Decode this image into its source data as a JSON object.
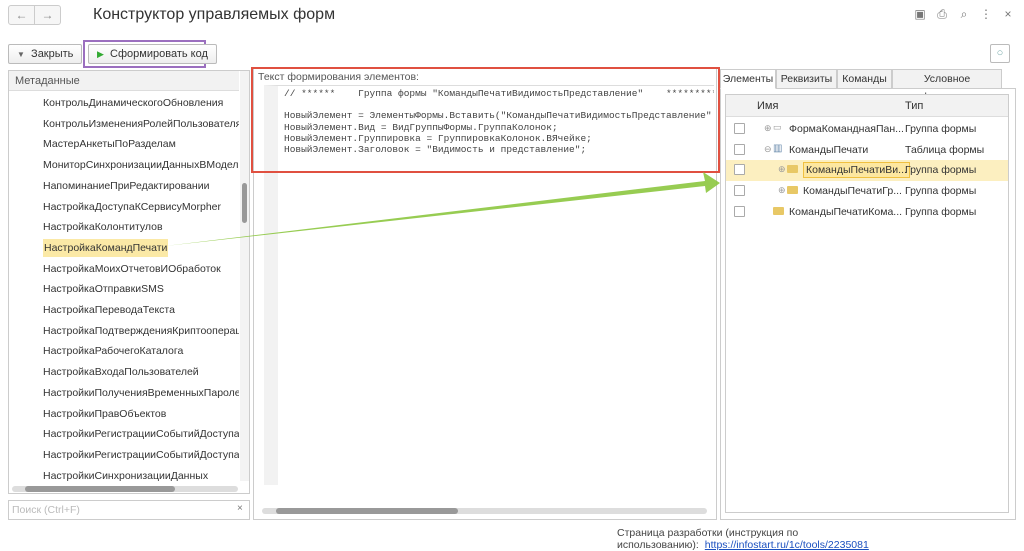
{
  "window": {
    "title": "Конструктор управляемых форм",
    "back": "←",
    "forward": "→"
  },
  "toolbar": {
    "close_label": "Закрыть",
    "generate_label": "Сформировать код"
  },
  "left": {
    "header": "Метаданные",
    "items": [
      "КонтрольДинамическогоОбновления",
      "КонтрольИзмененияРолейПользователяИБ",
      "МастерАнкетыПоРазделам",
      "МониторСинхронизацииДанныхВМоделиСерв",
      "НапоминаниеПриРедактировании",
      "НастройкаДоступаКСервисуMorpher",
      "НастройкаКолонтитулов",
      "НастройкаКомандПечати",
      "НастройкаМоихОтчетовИОбработок",
      "НастройкаОтправкиSMS",
      "НастройкаПереводаТекста",
      "НастройкаПодтвержденияКриптооперации",
      "НастройкаРабочегоКаталога",
      "НастройкаВходаПользователей",
      "НастройкиПолученияВременныхПаролей",
      "НастройкиПравОбъектов",
      "НастройкиРегистрацииСобытийДоступаКДанн",
      "НастройкиРегистрацииСобытийДоступаКПерс",
      "НастройкиСинхронизацииДанных"
    ],
    "selected_index": 7,
    "search_placeholder": "Поиск (Ctrl+F)",
    "search_clear": "×"
  },
  "middle": {
    "label": "Текст формирования элементов:",
    "code": "// ******    Группа формы \"КомандыПечатиВидимостьПредставление\"    **********\n\nНовыйЭлемент = ЭлементыФормы.Вставить(\"КомандыПечатиВидимостьПредставление\"\nНовыйЭлемент.Вид = ВидГруппыФормы.ГруппаКолонок;\nНовыйЭлемент.Группировка = ГруппировкаКолонок.ВЯчейке;\nНовыйЭлемент.Заголовок = \"Видимость и представление\";"
  },
  "right": {
    "tabs": [
      "Элементы",
      "Реквизиты",
      "Команды",
      "Условное оформление"
    ],
    "columns": {
      "name": "Имя",
      "type": "Тип"
    },
    "rows": [
      {
        "name": "ФормаКоманднаяПан...",
        "type": "Группа формы"
      },
      {
        "name": "КомандыПечати",
        "type": "Таблица формы"
      },
      {
        "name": "КомандыПечатиВи...",
        "type": "Группа формы"
      },
      {
        "name": "КомандыПечатиГр...",
        "type": "Группа формы"
      },
      {
        "name": "КомандыПечатиКома...",
        "type": "Группа формы"
      }
    ]
  },
  "footer": {
    "text": "Страница разработки (инструкция по использованию):",
    "link": "https://infostart.ru/1c/tools/2235081"
  },
  "colors": {
    "purple": "#9b6fbf",
    "red": "#e05040",
    "green": "#8cc63f",
    "selected": "#fbe9a6"
  }
}
